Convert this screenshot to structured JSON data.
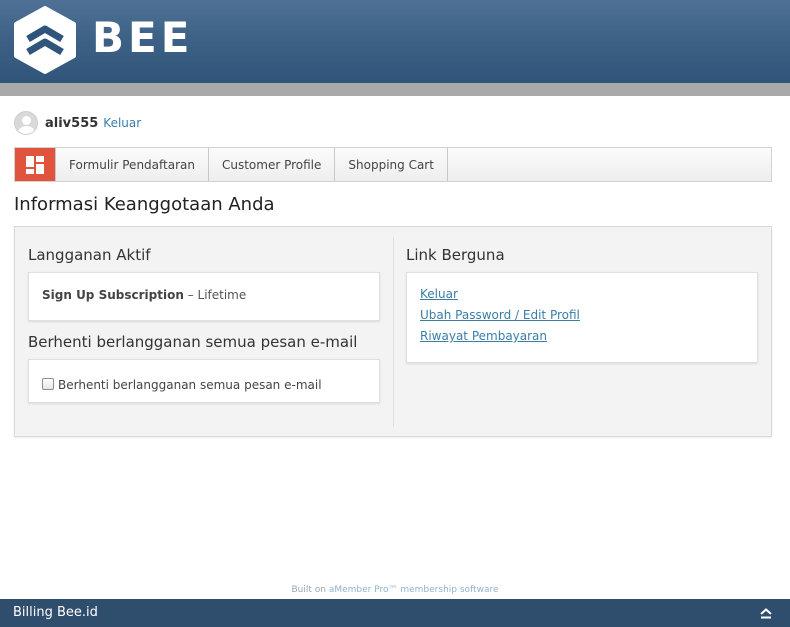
{
  "header": {
    "brand": "BEE",
    "logo_icon": "bee-hexagon-logo-icon",
    "colors": {
      "header_top": "#4f7196",
      "header_bottom": "#30557a",
      "accent": "#e0543d",
      "link": "#3a7ea8",
      "footer": "#2f4d6c"
    }
  },
  "user": {
    "avatar_icon": "user-avatar-icon",
    "username": "aliv555",
    "logout_label": "Keluar"
  },
  "nav": {
    "home_icon": "dashboard-grid-icon",
    "tabs": [
      {
        "label": "Formulir Pendaftaran"
      },
      {
        "label": "Customer Profile"
      },
      {
        "label": "Shopping Cart"
      }
    ]
  },
  "main": {
    "title": "Informasi Keanggotaan Anda",
    "active_subscriptions": {
      "title": "Langganan Aktif",
      "items": [
        {
          "name": "Sign Up Subscription",
          "separator": " – ",
          "term": "Lifetime"
        }
      ]
    },
    "unsubscribe": {
      "title": "Berhenti berlangganan semua pesan e-mail",
      "checkbox_label": "Berhenti berlangganan semua pesan e-mail",
      "checked": false
    },
    "useful_links": {
      "title": "Link Berguna",
      "links": [
        {
          "label": "Keluar"
        },
        {
          "label": "Ubah Password / Edit Profil"
        },
        {
          "label": "Riwayat Pembayaran"
        }
      ]
    }
  },
  "built_on": {
    "prefix": "Built on ",
    "link_label": "aMember Pro™ membership software"
  },
  "footer": {
    "title": "Billing Bee.id",
    "up_icon": "chevron-up-icon"
  }
}
